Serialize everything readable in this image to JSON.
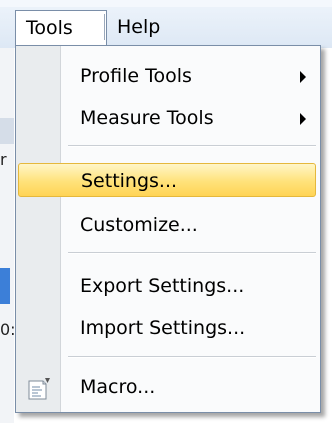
{
  "menubar": {
    "tools_label": "Tools",
    "help_label": "Help"
  },
  "background": {
    "fragment_1": "r",
    "fragment_2": "0:"
  },
  "tools_menu": {
    "profile_tools": "Profile Tools",
    "measure_tools": "Measure Tools",
    "settings": "Settings...",
    "customize": "Customize...",
    "export_settings": "Export Settings...",
    "import_settings": "Import Settings...",
    "macro": "Macro..."
  },
  "icons": {
    "submenu": "chevron-right-icon",
    "macro": "macro-script-icon"
  },
  "colors": {
    "highlight": "#ffe27a",
    "highlight_border": "#e5b83c",
    "gutter": "#e9ecee"
  }
}
